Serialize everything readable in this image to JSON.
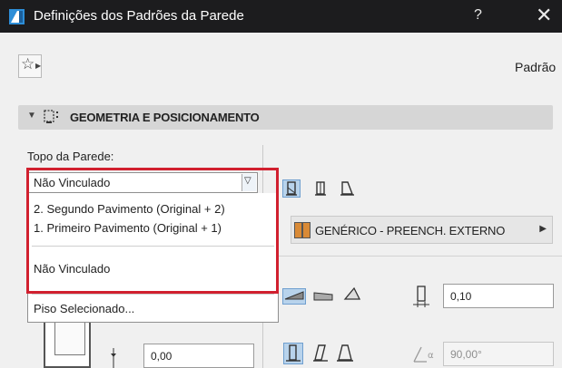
{
  "window": {
    "title": "Definições dos Padrões da Parede",
    "help_label": "?",
    "close_label": "✕"
  },
  "toolbar": {
    "preset_name": "Padrão"
  },
  "section": {
    "title": "GEOMETRIA E POSICIONAMENTO"
  },
  "top_of_wall": {
    "label": "Topo da Parede:",
    "selected": "Não Vinculado",
    "options": [
      "2. Segundo Pavimento (Original + 2)",
      "1. Primeiro Pavimento (Original + 1)",
      "Não Vinculado",
      "Piso Selecionado..."
    ]
  },
  "structure": {
    "composite_name": "GENÉRICO - PREENCH. EXTERNO"
  },
  "fields": {
    "thickness": "0,10",
    "offset": "0,00",
    "slant_angle": "90,00°"
  },
  "icons": {
    "app": "archicad-icon",
    "favorites": "star-icon",
    "section": "wall-geometry-icon"
  },
  "colors": {
    "highlight": "#d1202f",
    "titlebar": "#1c1c1e",
    "selection": "#b8d3ec"
  }
}
